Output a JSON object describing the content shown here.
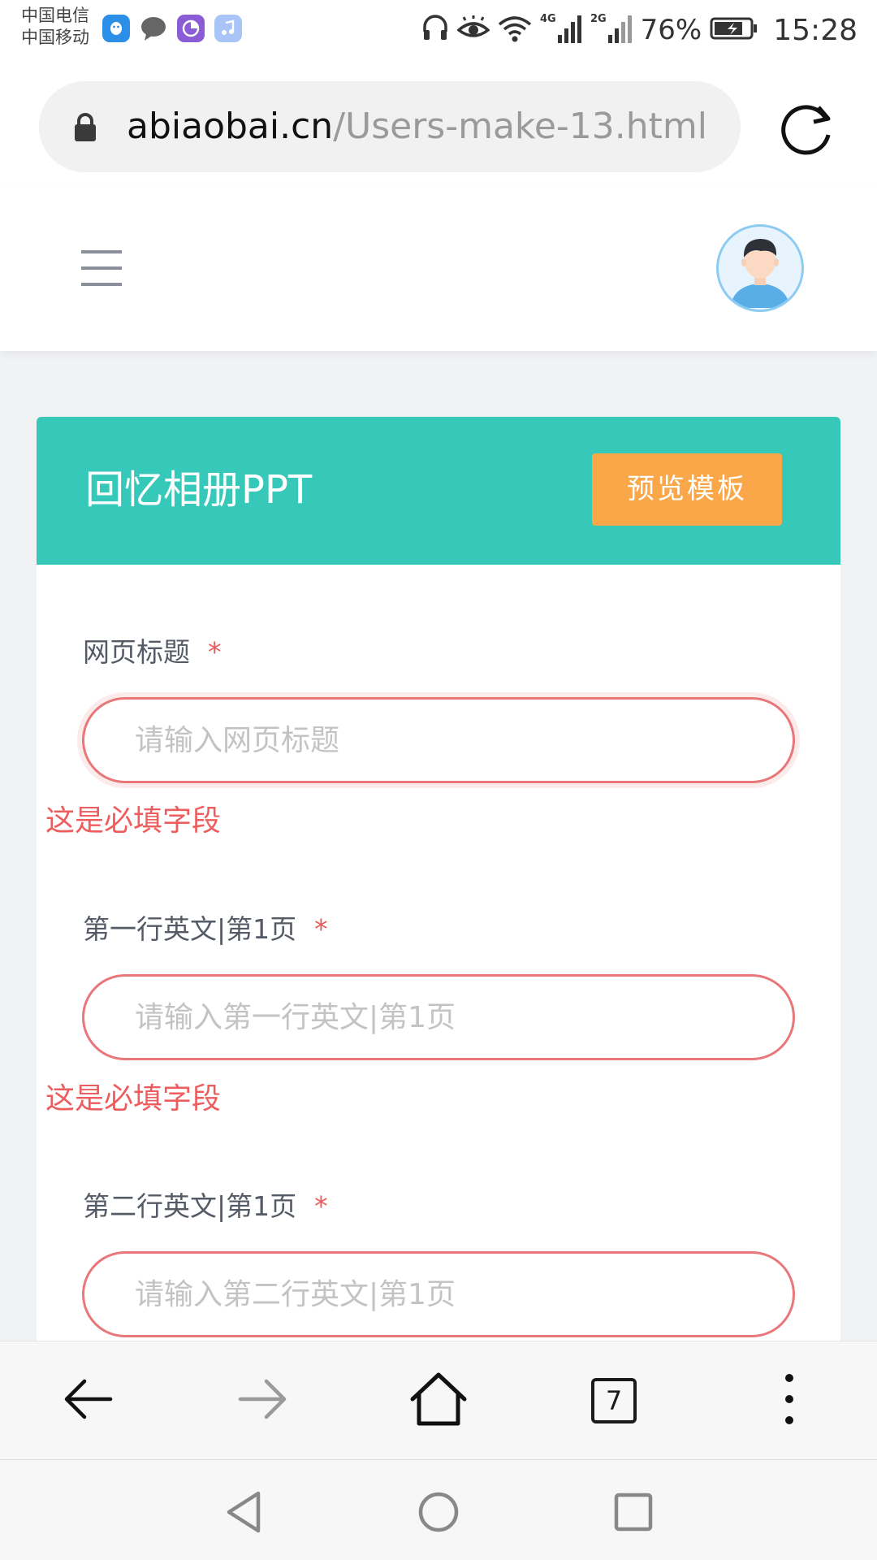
{
  "status_bar": {
    "carrier_1": "中国电信",
    "carrier_2": "中国移动",
    "network_1": "4G",
    "network_2": "2G",
    "battery_percent": "76%",
    "time": "15:28"
  },
  "browser": {
    "url_domain": "abiaobai.cn",
    "url_path": "/Users-make-13.html",
    "tab_count": "7"
  },
  "card": {
    "title": "回忆相册PPT",
    "preview_button": "预览模板"
  },
  "form": {
    "required_marker": "*",
    "fields": [
      {
        "label": "网页标题",
        "placeholder": "请输入网页标题",
        "value": "",
        "error": "这是必填字段"
      },
      {
        "label": "第一行英文|第1页",
        "placeholder": "请输入第一行英文|第1页",
        "value": "",
        "error": "这是必填字段"
      },
      {
        "label": "第二行英文|第1页",
        "placeholder": "请输入第二行英文|第1页",
        "value": "",
        "error": ""
      }
    ]
  },
  "icons": {
    "status_apps": [
      "qq-icon",
      "chat-icon",
      "sphere-app-icon",
      "music-app-icon"
    ],
    "status_system": [
      "headphones-icon",
      "eye-comfort-icon",
      "wifi-icon",
      "signal-4g-icon",
      "signal-2g-icon",
      "battery-charging-icon"
    ],
    "browser": [
      "lock-icon",
      "reload-icon",
      "back-arrow-icon",
      "forward-arrow-icon",
      "home-icon",
      "tabs-icon",
      "more-menu-icon"
    ],
    "nav": [
      "nav-back-icon",
      "nav-home-icon",
      "nav-recents-icon"
    ]
  },
  "colors": {
    "card_header": "#36c9b9",
    "preview_button": "#f9a748",
    "error": "#ee5d5d",
    "input_border": "#e9777a"
  }
}
